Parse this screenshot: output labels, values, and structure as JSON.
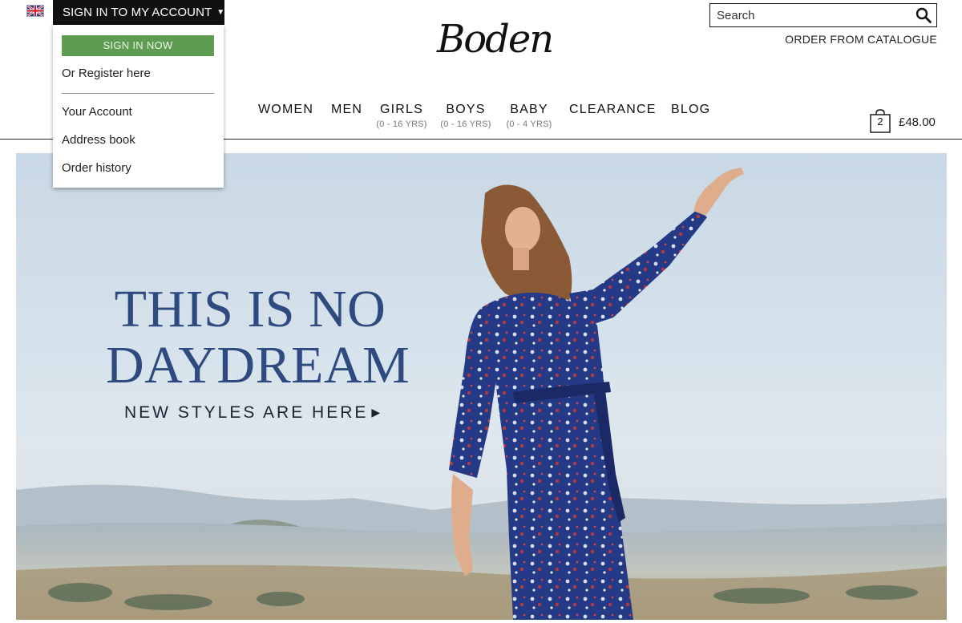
{
  "header": {
    "flag_icon": "uk-flag-icon",
    "account_toggle_label": "SIGN IN TO MY ACCOUNT",
    "logo_text": "Boden",
    "search": {
      "placeholder": "Search",
      "value": ""
    },
    "catalogue_label": "ORDER FROM CATALOGUE"
  },
  "account_menu": {
    "sign_in_label": "SIGN IN NOW",
    "register_label": "Or Register here",
    "links": [
      "Your Account",
      "Address book",
      "Order history"
    ]
  },
  "nav": {
    "items": [
      {
        "label": "WOMEN",
        "sub": ""
      },
      {
        "label": "MEN",
        "sub": ""
      },
      {
        "label": "GIRLS",
        "sub": "(0 - 16 YRS)"
      },
      {
        "label": "BOYS",
        "sub": "(0 - 16 YRS)"
      },
      {
        "label": "BABY",
        "sub": "(0 - 4 YRS)"
      },
      {
        "label": "CLEARANCE",
        "sub": ""
      },
      {
        "label": "BLOG",
        "sub": ""
      }
    ]
  },
  "basket": {
    "count": "2",
    "total": "£48.00"
  },
  "hero": {
    "headline_line1": "THIS IS NO",
    "headline_line2": "DAYDREAM",
    "cta": "NEW STYLES ARE HERE"
  },
  "colors": {
    "accent_green": "#5e9c51",
    "headline_navy": "#2f4a7e",
    "dress_blue": "#243a86"
  }
}
